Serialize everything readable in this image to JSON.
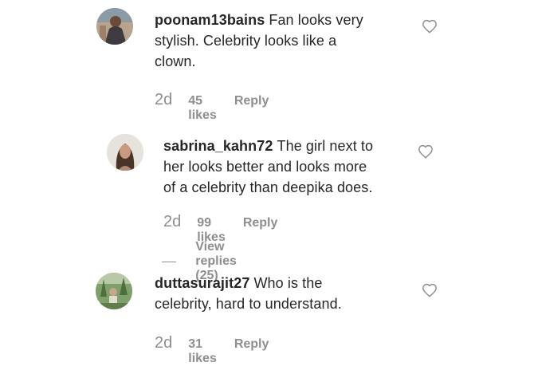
{
  "comments": [
    {
      "username": "poonam13bains",
      "lines": [
        "Fan looks very",
        "stylish. Celebrity looks like a",
        "clown."
      ],
      "time": "2d",
      "likes": "45 likes",
      "reply": "Reply"
    },
    {
      "username": "sabrina_kahn72",
      "lines": [
        "The girl next to",
        "her looks better and looks more",
        "of a celebrity than deepika does."
      ],
      "time": "2d",
      "likes": "99 likes",
      "reply": "Reply",
      "view_replies": "View replies (25)"
    },
    {
      "username": "duttasurajit27",
      "lines": [
        "Who is the",
        "celebrity, hard to understand."
      ],
      "time": "2d",
      "likes": "31 likes",
      "reply": "Reply"
    }
  ],
  "icons": {
    "like": "heart-outline-icon",
    "avatar": "user-avatar"
  },
  "colors": {
    "text": "#262626",
    "secondary": "#8e8e8e",
    "background": "#ffffff"
  }
}
